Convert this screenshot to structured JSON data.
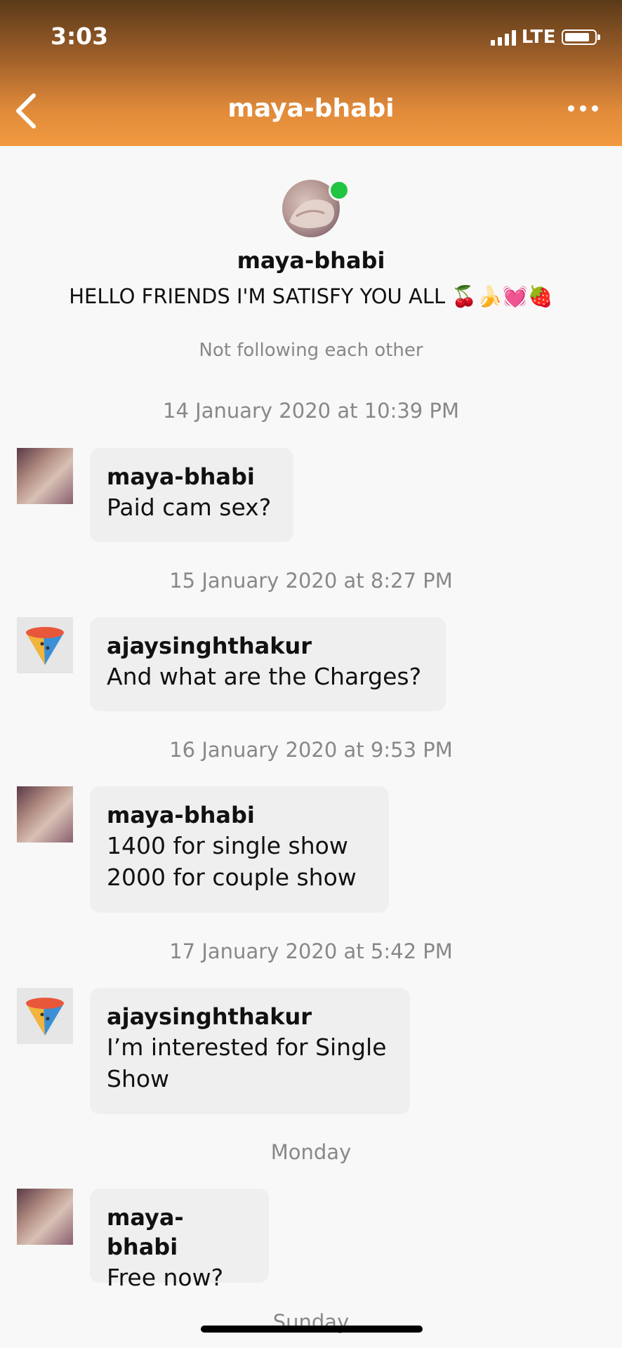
{
  "status_bar": {
    "time": "3:03",
    "network": "LTE"
  },
  "nav": {
    "title": "maya-bhabi",
    "back_icon": "chevron-left-icon",
    "more_icon": "more-horizontal-icon"
  },
  "profile": {
    "name": "maya-bhabi",
    "bio": "HELLO FRIENDS I'M SATISFY YOU ALL 🍒🍌💓🍓",
    "follow_status": "Not following each other",
    "online": true
  },
  "timeline": [
    {
      "timestamp": "14 January 2020 at 10:39 PM",
      "sender": "maya-bhabi",
      "avatar": "photo",
      "lines": [
        "Paid cam sex?"
      ]
    },
    {
      "timestamp": "15 January 2020 at 8:27 PM",
      "sender": "ajaysinghthakur",
      "avatar": "cone",
      "lines": [
        "And what are the Charges?"
      ]
    },
    {
      "timestamp": "16 January 2020 at 9:53 PM",
      "sender": "maya-bhabi",
      "avatar": "photo",
      "lines": [
        "1400 for single show",
        "2000 for couple show"
      ]
    },
    {
      "timestamp": "17 January 2020 at 5:42 PM",
      "sender": "ajaysinghthakur",
      "avatar": "cone",
      "lines": [
        "I’m interested for Single",
        "Show"
      ]
    },
    {
      "timestamp": "Monday",
      "sender": "maya-bhabi",
      "avatar": "photo",
      "lines": [
        "Free now?"
      ]
    }
  ],
  "next_day_label": "Sunday",
  "colors": {
    "header_top": "#5a3a18",
    "header_bottom": "#f29a40",
    "online": "#21c542",
    "bubble": "#efefef"
  }
}
